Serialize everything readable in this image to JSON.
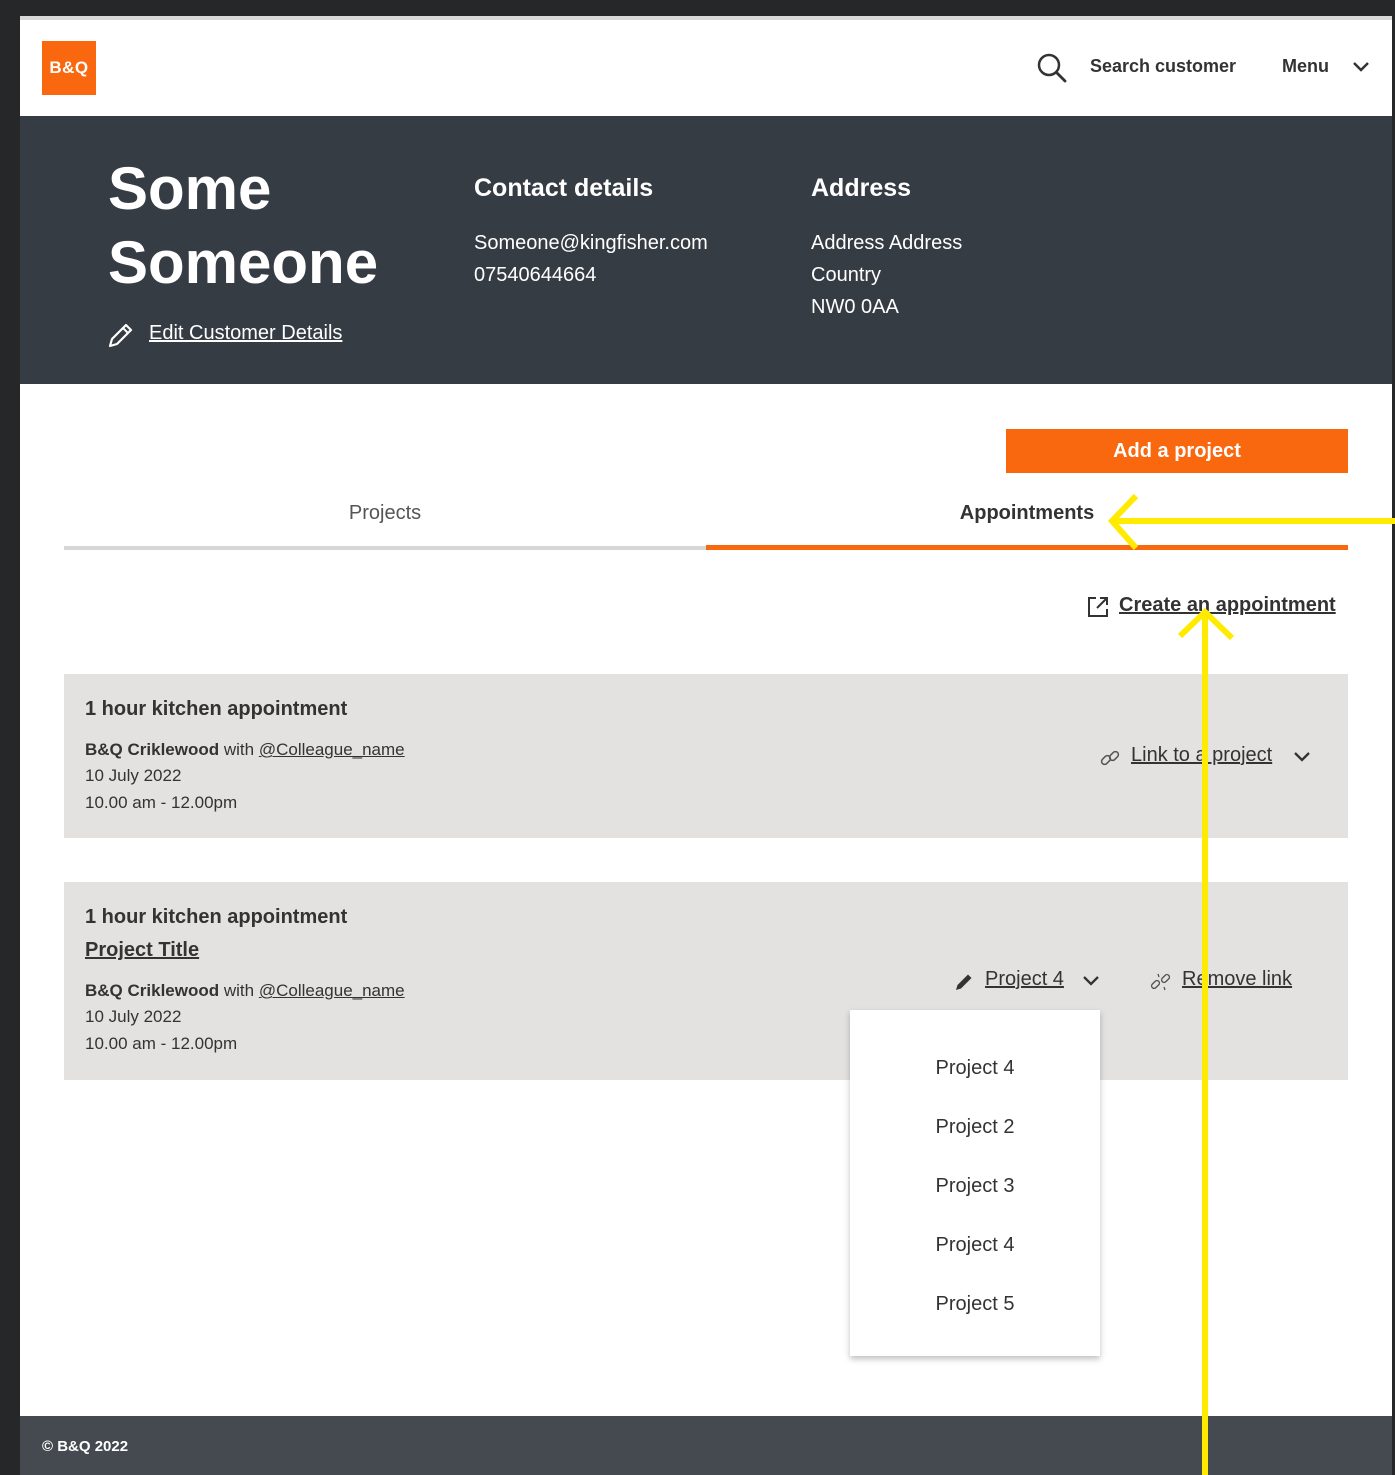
{
  "brand": {
    "logo_text": "B&Q",
    "accent_color": "#f9670f",
    "header_bg": "#363c43",
    "annotation_color": "#ffeb00"
  },
  "topbar": {
    "search_label": "Search customer",
    "menu_label": "Menu"
  },
  "customer": {
    "name_first": "Some",
    "name_last": "Someone",
    "edit_link": "Edit Customer Details",
    "contact_heading": "Contact details",
    "email": "Someone@kingfisher.com",
    "phone": "07540644664",
    "address_heading": "Address",
    "address_line1": "Address Address",
    "address_line2": "Country",
    "postcode": "NW0 0AA"
  },
  "actions": {
    "add_project": "Add a project",
    "create_appointment": "Create an appointment"
  },
  "tabs": [
    {
      "label": "Projects",
      "active": false
    },
    {
      "label": "Appointments",
      "active": true
    }
  ],
  "appointments": [
    {
      "title": "1 hour kitchen appointment",
      "store": "B&Q Criklewood",
      "with_word": "with",
      "colleague": "@Colleague_name",
      "date": "10 July 2022",
      "time": "10.00 am - 12.00pm",
      "link_label": "Link to a project"
    },
    {
      "title": "1 hour kitchen appointment",
      "project_title": "Project Title",
      "store": "B&Q Criklewood",
      "with_word": "with",
      "colleague": "@Colleague_name",
      "date": "10 July 2022",
      "time": "10.00 am - 12.00pm",
      "selected_project": "Project 4",
      "remove_label": "Remove link"
    }
  ],
  "project_dropdown": {
    "options": [
      "Project 4",
      "Project 2",
      "Project 3",
      "Project 4",
      "Project 5"
    ]
  },
  "footer": {
    "copyright": "© B&Q 2022"
  }
}
